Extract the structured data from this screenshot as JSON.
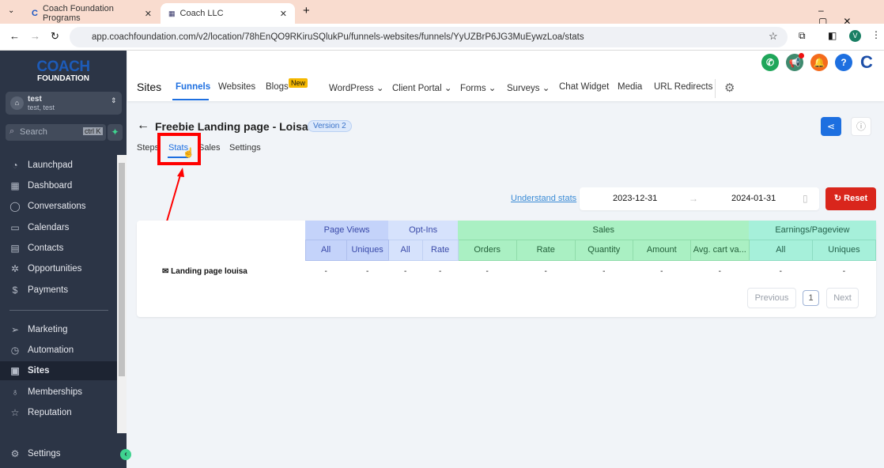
{
  "browser": {
    "tabs": [
      {
        "title": "Coach Foundation Programs"
      },
      {
        "title": "Coach LLC"
      }
    ],
    "url": "app.coachfoundation.com/v2/location/78hEnQO9RKiruSQlukPu/funnels-websites/funnels/YyUZBrP6JG3MuEywzLoa/stats",
    "profile_initial": "V"
  },
  "sidebar": {
    "logo_top": "COACH",
    "logo_bottom": "FOUNDATION",
    "account_name": "test",
    "account_sub": "test, test",
    "search_placeholder": "Search",
    "search_shortcut": "ctrl K",
    "items": [
      {
        "label": "Launchpad",
        "icon": "rocket-icon"
      },
      {
        "label": "Dashboard",
        "icon": "grid-icon"
      },
      {
        "label": "Conversations",
        "icon": "chat-icon"
      },
      {
        "label": "Calendars",
        "icon": "calendar-icon"
      },
      {
        "label": "Contacts",
        "icon": "contacts-icon"
      },
      {
        "label": "Opportunities",
        "icon": "opportunities-icon"
      },
      {
        "label": "Payments",
        "icon": "payments-icon"
      },
      {
        "label": "Marketing",
        "icon": "send-icon"
      },
      {
        "label": "Automation",
        "icon": "automation-icon"
      },
      {
        "label": "Sites",
        "icon": "sites-icon"
      },
      {
        "label": "Memberships",
        "icon": "award-icon"
      },
      {
        "label": "Reputation",
        "icon": "star-icon"
      }
    ],
    "settings": "Settings"
  },
  "header": {
    "section": "Sites",
    "nav": [
      {
        "label": "Funnels"
      },
      {
        "label": "Websites"
      },
      {
        "label": "Blogs",
        "badge": "New"
      },
      {
        "label": "WordPress"
      },
      {
        "label": "Client Portal"
      },
      {
        "label": "Forms"
      },
      {
        "label": "Surveys"
      },
      {
        "label": "Chat Widget"
      },
      {
        "label": "Media"
      },
      {
        "label": "URL Redirects"
      }
    ],
    "brand_initial": "C"
  },
  "page": {
    "title": "Freebie Landing page - Loisa",
    "version": "Version 2",
    "tabs": [
      "Steps",
      "Stats",
      "Sales",
      "Settings"
    ],
    "active_tab": "Stats",
    "understand_stats": "Understand stats",
    "date_from": "2023-12-31",
    "date_to": "2024-01-31",
    "reset": "Reset"
  },
  "table": {
    "groups": [
      "Page Views",
      "Opt-Ins",
      "Sales",
      "Earnings/Pageview"
    ],
    "columns": [
      "All",
      "Uniques",
      "All",
      "Rate",
      "Orders",
      "Rate",
      "Quantity",
      "Amount",
      "Avg. cart va...",
      "All",
      "Uniques"
    ],
    "rows": [
      {
        "name": "Landing page louisa",
        "values": [
          "-",
          "-",
          "-",
          "-",
          "-",
          "-",
          "-",
          "-",
          "-",
          "-",
          "-"
        ]
      }
    ]
  },
  "pagination": {
    "previous": "Previous",
    "page": "1",
    "next": "Next"
  },
  "colors": {
    "accent": "#1d6fe0",
    "reset": "#d9261c",
    "highlight": "#ff0000"
  }
}
